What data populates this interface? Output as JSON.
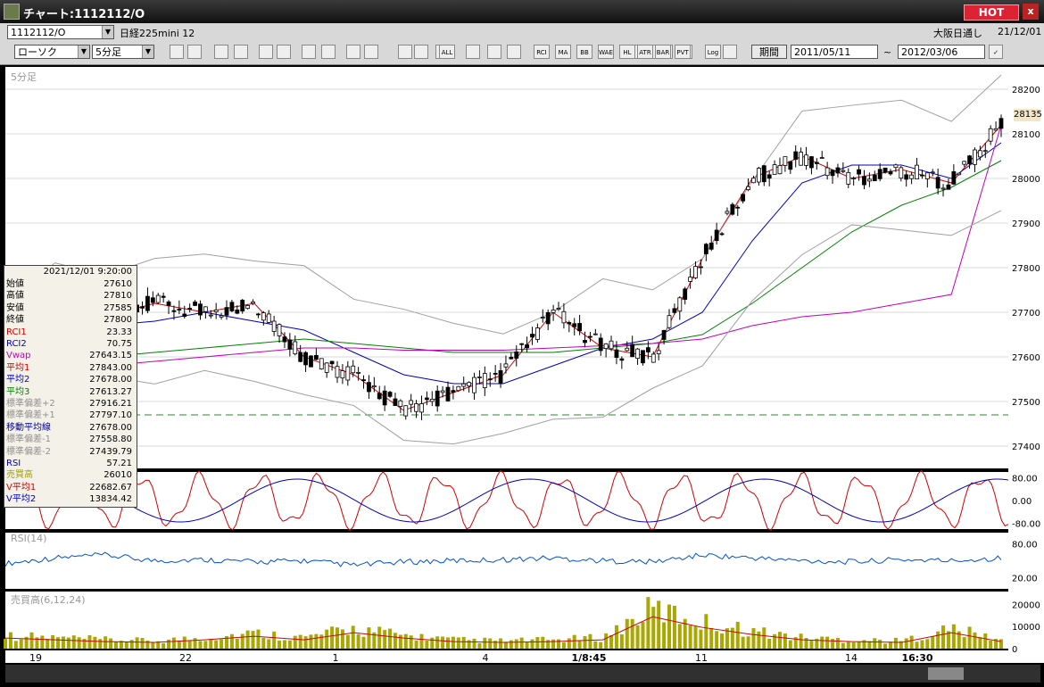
{
  "window": {
    "title": "チャート:1112112/O",
    "hot_label": "HOT",
    "close_label": "x"
  },
  "symbol_bar": {
    "code": "1112112/O",
    "name": "日経225mini 12",
    "session": "大阪日通し",
    "date": "21/12/01"
  },
  "toolbar": {
    "chart_type": "ローソク",
    "interval": "5分足",
    "period_button": "期間",
    "date_from": "2011/05/11",
    "date_to": "2012/03/06",
    "tilde": "~",
    "tools": [
      "RCI",
      "MA",
      "BB",
      "WAE",
      "HL",
      "ATR",
      "BAR",
      "PVT",
      "Log",
      "ALL"
    ]
  },
  "panels": {
    "main_label": "5分足",
    "rsi_label": "RSI(14)",
    "volume_label": "売買高(6,12,24)",
    "current_price_badge": "28135"
  },
  "price_axis": [
    "28200",
    "28100",
    "28000",
    "27900",
    "27800",
    "27700",
    "27600",
    "27500",
    "27400"
  ],
  "rci_axis": [
    "80.00",
    "0.00",
    "-80.00"
  ],
  "rsi_axis": [
    "80.00",
    "20.00"
  ],
  "volume_axis": [
    "20000",
    "10000",
    "0"
  ],
  "time_axis": [
    "19",
    "22",
    "1",
    "4",
    "1/8:45",
    "11",
    "14",
    "16:30"
  ],
  "infobox": {
    "datetime": "2021/12/01 9:20:00",
    "rows": [
      {
        "k": "始値",
        "v": "27610",
        "color": "#000000"
      },
      {
        "k": "高値",
        "v": "27810",
        "color": "#000000"
      },
      {
        "k": "安値",
        "v": "27585",
        "color": "#000000"
      },
      {
        "k": "終値",
        "v": "27800",
        "color": "#000000"
      },
      {
        "k": "RCI1",
        "v": "23.33",
        "color": "#d00000"
      },
      {
        "k": "RCI2",
        "v": "70.75",
        "color": "#0000c0"
      },
      {
        "k": "Vwap",
        "v": "27643.15",
        "color": "#c000c0"
      },
      {
        "k": "平均1",
        "v": "27843.00",
        "color": "#d00000"
      },
      {
        "k": "平均2",
        "v": "27678.00",
        "color": "#0000c0"
      },
      {
        "k": "平均3",
        "v": "27613.27",
        "color": "#008000"
      },
      {
        "k": "標準偏差+2",
        "v": "27916.21",
        "color": "#909090"
      },
      {
        "k": "標準偏差+1",
        "v": "27797.10",
        "color": "#909090"
      },
      {
        "k": "移動平均線",
        "v": "27678.00",
        "color": "#0000a0"
      },
      {
        "k": "標準偏差-1",
        "v": "27558.80",
        "color": "#909090"
      },
      {
        "k": "標準偏差-2",
        "v": "27439.79",
        "color": "#909090"
      },
      {
        "k": "RSI",
        "v": "57.21",
        "color": "#0000c0"
      },
      {
        "k": "売買高",
        "v": "26010",
        "color": "#a0a000"
      },
      {
        "k": "V平均1",
        "v": "22682.67",
        "color": "#d00000"
      },
      {
        "k": "V平均2",
        "v": "13834.42",
        "color": "#0000c0"
      }
    ]
  },
  "chart_data": {
    "type": "line",
    "ylim": [
      27350,
      28250
    ],
    "x": [
      0,
      5,
      10,
      15,
      20,
      25,
      30,
      35,
      40,
      45,
      50,
      55,
      60,
      65,
      70,
      75,
      80,
      85,
      90,
      95,
      100
    ],
    "series": [
      {
        "name": "平均1",
        "values": [
          27640,
          27700,
          27690,
          27720,
          27700,
          27720,
          27600,
          27560,
          27480,
          27520,
          27560,
          27700,
          27620,
          27600,
          27820,
          28000,
          28050,
          28000,
          28020,
          27990,
          28120
        ]
      },
      {
        "name": "平均2",
        "values": [
          27620,
          27650,
          27670,
          27680,
          27700,
          27680,
          27660,
          27610,
          27560,
          27540,
          27540,
          27580,
          27620,
          27640,
          27700,
          27860,
          27990,
          28030,
          28030,
          28000,
          28080
        ]
      },
      {
        "name": "平均3",
        "values": [
          27640,
          27610,
          27600,
          27610,
          27620,
          27630,
          27640,
          27630,
          27620,
          27610,
          27610,
          27610,
          27620,
          27630,
          27650,
          27720,
          27800,
          27880,
          27940,
          27980,
          28040
        ]
      },
      {
        "name": "Vwap",
        "values": [
          27560,
          27570,
          27580,
          27590,
          27600,
          27610,
          27620,
          27620,
          27615,
          27615,
          27615,
          27620,
          27625,
          27630,
          27640,
          27670,
          27690,
          27700,
          27720,
          27740,
          28120
        ]
      },
      {
        "name": "RSI",
        "values": [
          45,
          55,
          60,
          50,
          52,
          48,
          50,
          42,
          48,
          50,
          52,
          55,
          50,
          48,
          60,
          55,
          50,
          48,
          52,
          50,
          55
        ]
      },
      {
        "name": "売買高",
        "values": [
          6000,
          5000,
          4000,
          3500,
          5000,
          7000,
          5000,
          9000,
          6000,
          4000,
          3500,
          4000,
          5000,
          18000,
          12000,
          8000,
          5000,
          4000,
          3500,
          9000,
          4000
        ]
      }
    ]
  }
}
